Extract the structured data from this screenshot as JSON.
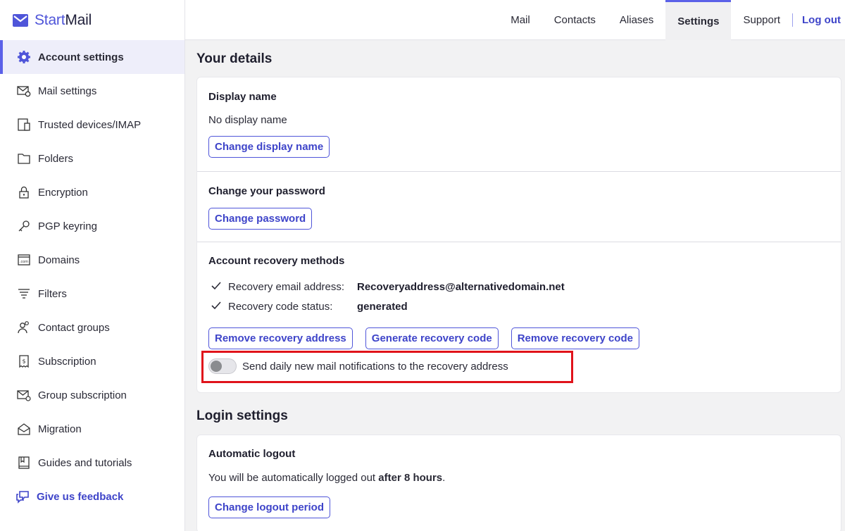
{
  "brand": {
    "start": "Start",
    "mail": "Mail",
    "icon": "envelope-icon"
  },
  "sidebar": {
    "items": [
      {
        "label": "Account settings",
        "icon": "gear-icon",
        "active": true
      },
      {
        "label": "Mail settings",
        "icon": "mail-gear-icon"
      },
      {
        "label": "Trusted devices/IMAP",
        "icon": "devices-icon"
      },
      {
        "label": "Folders",
        "icon": "folder-icon"
      },
      {
        "label": "Encryption",
        "icon": "lock-icon"
      },
      {
        "label": "PGP keyring",
        "icon": "key-icon"
      },
      {
        "label": "Domains",
        "icon": "domain-icon"
      },
      {
        "label": "Filters",
        "icon": "filter-icon"
      },
      {
        "label": "Contact groups",
        "icon": "contact-group-icon"
      },
      {
        "label": "Subscription",
        "icon": "receipt-icon"
      },
      {
        "label": "Group subscription",
        "icon": "group-mail-icon"
      },
      {
        "label": "Migration",
        "icon": "migration-icon"
      },
      {
        "label": "Guides and tutorials",
        "icon": "book-icon"
      }
    ],
    "feedback": {
      "label": "Give us feedback",
      "icon": "chat-icon"
    }
  },
  "topnav": {
    "items": [
      "Mail",
      "Contacts",
      "Aliases",
      "Settings",
      "Support"
    ],
    "active": "Settings",
    "logout": "Log out"
  },
  "your_details": {
    "title": "Your details",
    "display_name": {
      "heading": "Display name",
      "value": "No display name",
      "button": "Change display name"
    },
    "password": {
      "heading": "Change your password",
      "button": "Change password"
    },
    "recovery": {
      "heading": "Account recovery methods",
      "rows": [
        {
          "label": "Recovery email address:",
          "value": "Recoveryaddress@alternativedomain.net"
        },
        {
          "label": "Recovery code status:",
          "value": "generated"
        }
      ],
      "buttons": [
        "Remove recovery address",
        "Generate recovery code",
        "Remove recovery code"
      ],
      "toggle_label": "Send daily new mail notifications to the recovery address",
      "toggle_on": false
    }
  },
  "login_settings": {
    "title": "Login settings",
    "auto_logout": {
      "heading": "Automatic logout",
      "text_prefix": "You will be automatically logged out ",
      "text_bold": "after 8 hours",
      "text_suffix": ".",
      "button": "Change logout period"
    }
  },
  "colors": {
    "accent": "#4f55d9",
    "highlight": "#e0131b",
    "toggle_knob": "#8a8c8f"
  }
}
